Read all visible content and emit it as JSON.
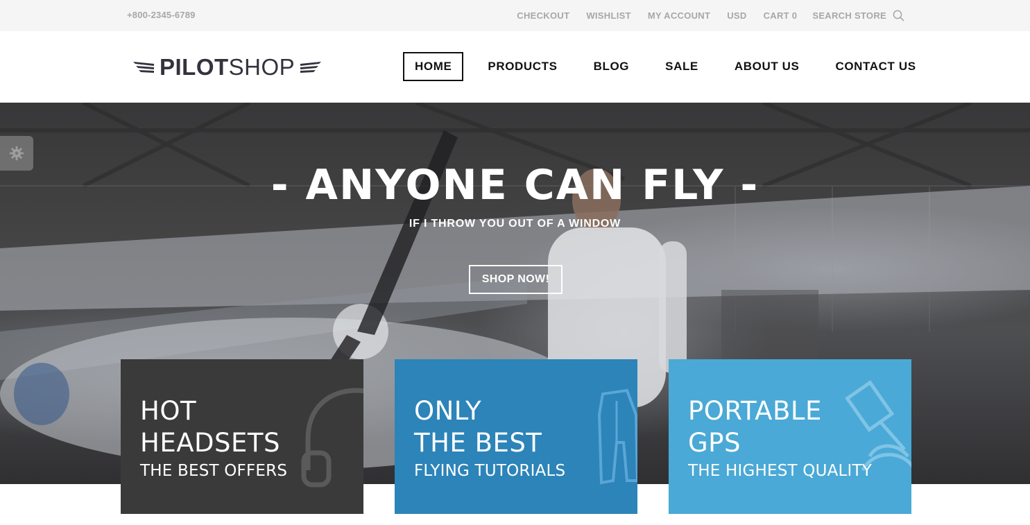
{
  "topbar": {
    "phone": "+800-2345-6789",
    "links": [
      "CHECKOUT",
      "WISHLIST",
      "MY ACCOUNT",
      "USD",
      "CART 0"
    ],
    "search_label": "SEARCH STORE",
    "search_icon": "search-icon"
  },
  "header": {
    "logo": {
      "bold": "PILOT",
      "light": "SHOP",
      "icon": "wings-icon"
    },
    "nav": [
      "HOME",
      "PRODUCTS",
      "BLOG",
      "SALE",
      "ABOUT US",
      "CONTACT US"
    ],
    "active_nav": "HOME"
  },
  "hero": {
    "title": "- ANYONE CAN FLY -",
    "subtitle": "IF I THROW YOU OUT OF A WINDOW",
    "button": "SHOP NOW!",
    "settings_icon": "gear-icon"
  },
  "cards": [
    {
      "line1": "HOT",
      "line2": "HEADSETS",
      "line3": "THE BEST OFFERS",
      "icon": "headset-icon",
      "color": "#3a3a3a"
    },
    {
      "line1": "ONLY",
      "line2": "THE BEST",
      "line3": "FLYING TUTORIALS",
      "icon": "pilot-suit-icon",
      "color": "#2c84b9"
    },
    {
      "line1": "PORTABLE",
      "line2": "GPS",
      "line3": "THE HIGHEST QUALITY",
      "icon": "satellite-icon",
      "color": "#4aa9d6"
    }
  ],
  "colors": {
    "text_dark": "#33323d",
    "topbar_bg": "#f5f5f5",
    "topbar_text": "#a7a7a7"
  }
}
